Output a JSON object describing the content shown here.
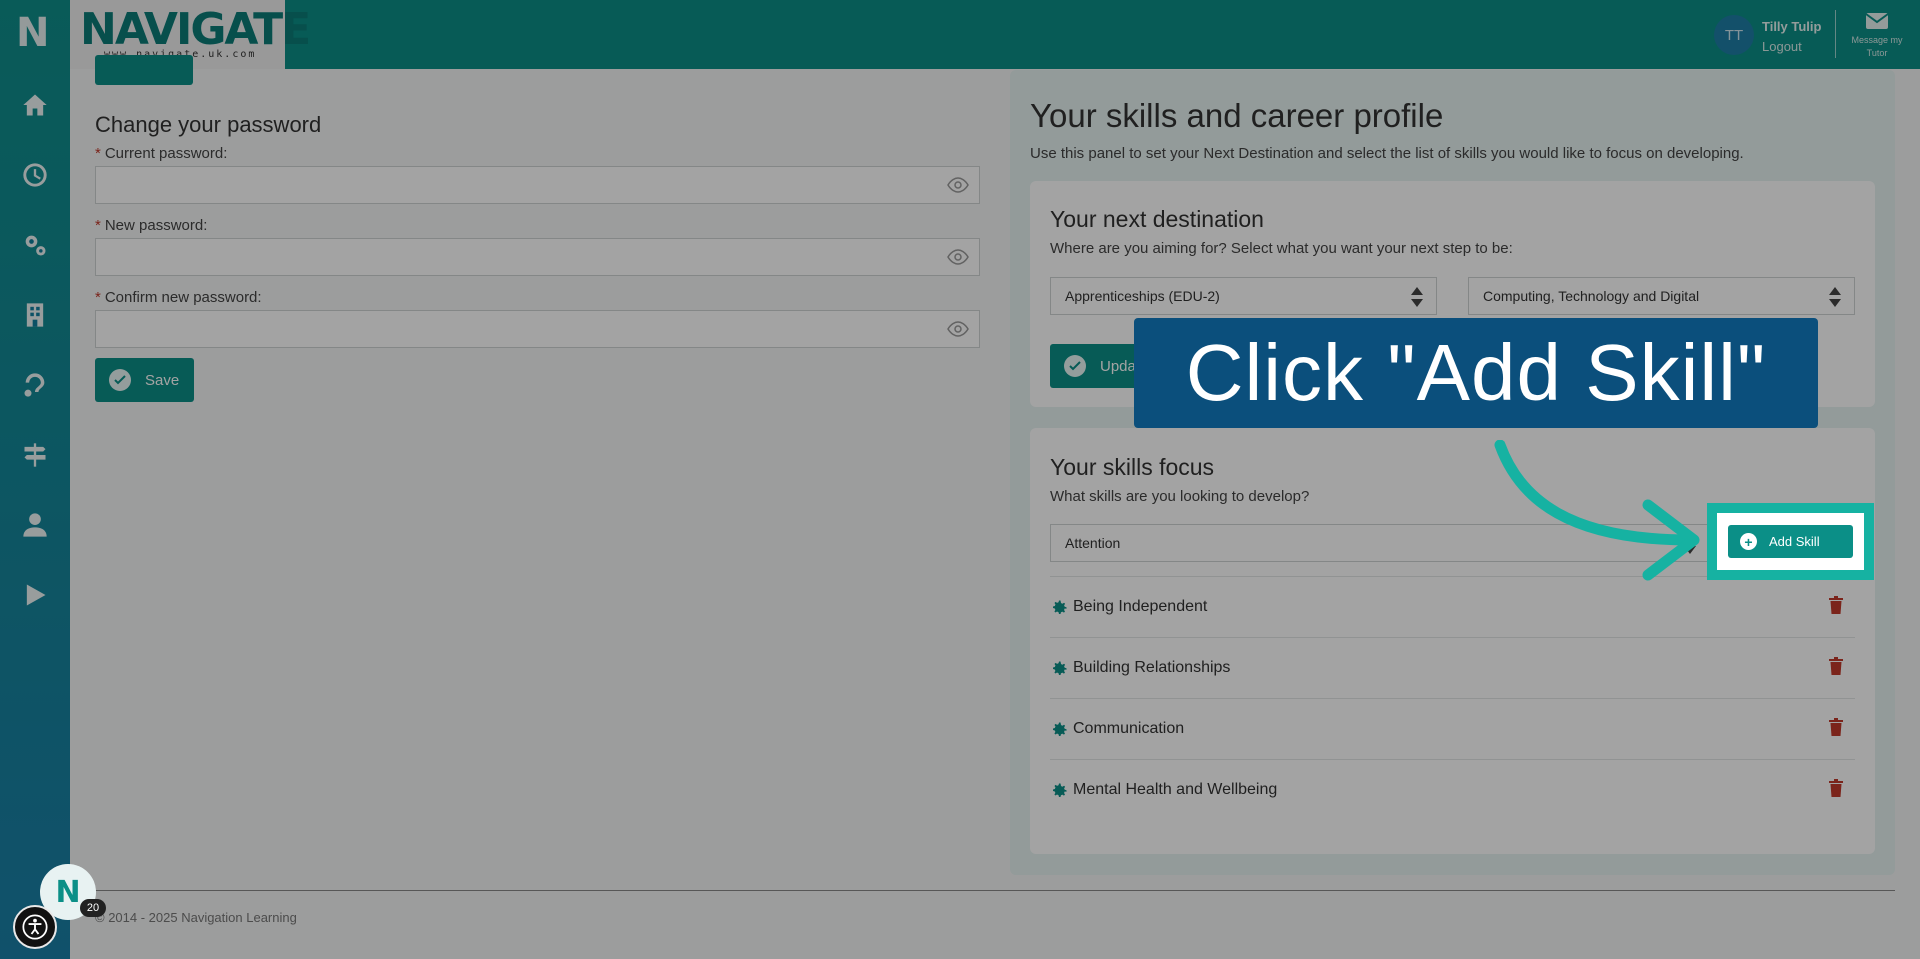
{
  "header": {
    "logo_letter": "N",
    "brand": "NAVIGATE",
    "brand_url": "www.navigate.uk.com",
    "user_initials": "TT",
    "user_name": "Tilly Tulip",
    "logout_label": "Logout",
    "message_label": "Message my Tutor"
  },
  "sidebar": {
    "items": [
      "home-icon",
      "clock-icon",
      "cogs-icon",
      "building-icon",
      "hand-icon",
      "signpost-icon",
      "user-icon",
      "play-icon"
    ]
  },
  "password": {
    "title": "Change your password",
    "fields": [
      {
        "label": "Current password:",
        "value": ""
      },
      {
        "label": "New password:",
        "value": ""
      },
      {
        "label": "Confirm new password:",
        "value": ""
      }
    ],
    "required_mark": "*",
    "save_label": "Save"
  },
  "profile": {
    "title": "Your skills and career profile",
    "description": "Use this panel to set your Next Destination and select the list of skills you would like to focus on developing.",
    "destination": {
      "title": "Your next destination",
      "description": "Where are you aiming for? Select what you want your next step to be:",
      "select_1": "Apprenticeships (EDU-2)",
      "select_2": "Computing, Technology and Digital",
      "update_label": "Update"
    },
    "skills": {
      "title": "Your skills focus",
      "description": "What skills are you looking to develop?",
      "select_value": "Attention",
      "add_label": "Add Skill",
      "items": [
        "Being Independent",
        "Building Relationships",
        "Communication",
        "Mental Health and Wellbeing"
      ]
    }
  },
  "footer": {
    "copyright": "© 2014 - 2025 Navigation Learning"
  },
  "overlay": {
    "callout_text": "Click \"Add Skill\"",
    "chat_letter": "N",
    "badge_count": "20"
  },
  "colors": {
    "teal": "#0b8f87",
    "callout_bg": "#0b4f7c",
    "highlight": "#16b2a2",
    "danger": "#c0392b"
  }
}
